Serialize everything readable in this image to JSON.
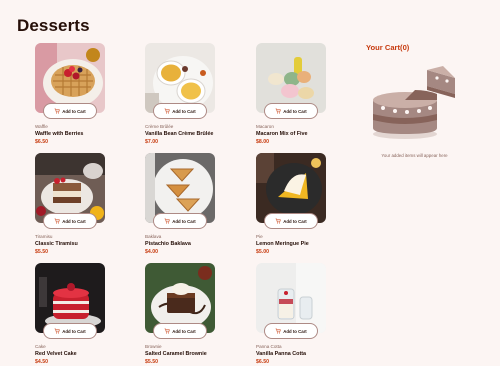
{
  "page": {
    "title": "Desserts"
  },
  "colors": {
    "accent": "#c73b0f",
    "background": "#fcf5f3",
    "text": "#260f08",
    "muted": "#87635a"
  },
  "products": [
    {
      "category": "Waffle",
      "name": "Waffle with Berries",
      "price": "$6.50",
      "button": "Add to Cart"
    },
    {
      "category": "Crème Brûlée",
      "name": "Vanilla Bean Crème Brûlée",
      "price": "$7.00",
      "button": "Add to Cart"
    },
    {
      "category": "Macaron",
      "name": "Macaron Mix of Five",
      "price": "$8.00",
      "button": "Add to Cart"
    },
    {
      "category": "Tiramisu",
      "name": "Classic Tiramisu",
      "price": "$5.50",
      "button": "Add to Cart"
    },
    {
      "category": "Baklava",
      "name": "Pistachio Baklava",
      "price": "$4.00",
      "button": "Add to Cart"
    },
    {
      "category": "Pie",
      "name": "Lemon Meringue Pie",
      "price": "$5.00",
      "button": "Add to Cart"
    },
    {
      "category": "Cake",
      "name": "Red Velvet Cake",
      "price": "$4.50",
      "button": "Add to Cart"
    },
    {
      "category": "Brownie",
      "name": "Salted Caramel Brownie",
      "price": "$5.50",
      "button": "Add to Cart"
    },
    {
      "category": "Panna Cotta",
      "name": "Vanilla Panna Cotta",
      "price": "$6.50",
      "button": "Add to Cart"
    }
  ],
  "cart": {
    "title": "Your Cart(0)",
    "empty_message": "Your added items will appear here",
    "empty_icon": "empty-cake-icon"
  }
}
